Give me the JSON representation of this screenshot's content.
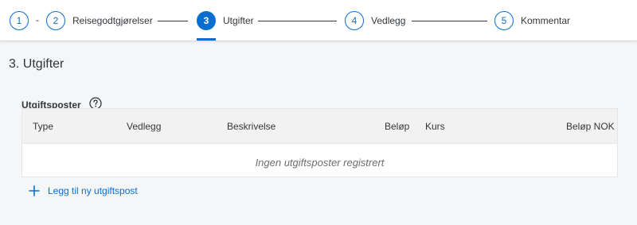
{
  "wizard": {
    "steps": [
      {
        "number": "1",
        "label": ""
      },
      {
        "number": "2",
        "label": "Reisegodtgjørelser"
      },
      {
        "number": "3",
        "label": "Utgifter"
      },
      {
        "number": "4",
        "label": "Vedlegg"
      },
      {
        "number": "5",
        "label": "Kommentar"
      }
    ],
    "separator": "-",
    "active_step": 3,
    "colors": {
      "accent": "#0a6ed1"
    }
  },
  "section": {
    "title": "3. Utgifter"
  },
  "expenses": {
    "title": "Utgiftsposter",
    "help_icon": "help-circle-icon",
    "columns": [
      "Type",
      "Vedlegg",
      "Beskrivelse",
      "Beløp",
      "Kurs",
      "Beløp NOK"
    ],
    "empty_text": "Ingen utgiftsposter registrert",
    "add_label": "Legg til ny utgiftspost",
    "add_icon": "plus-icon"
  }
}
